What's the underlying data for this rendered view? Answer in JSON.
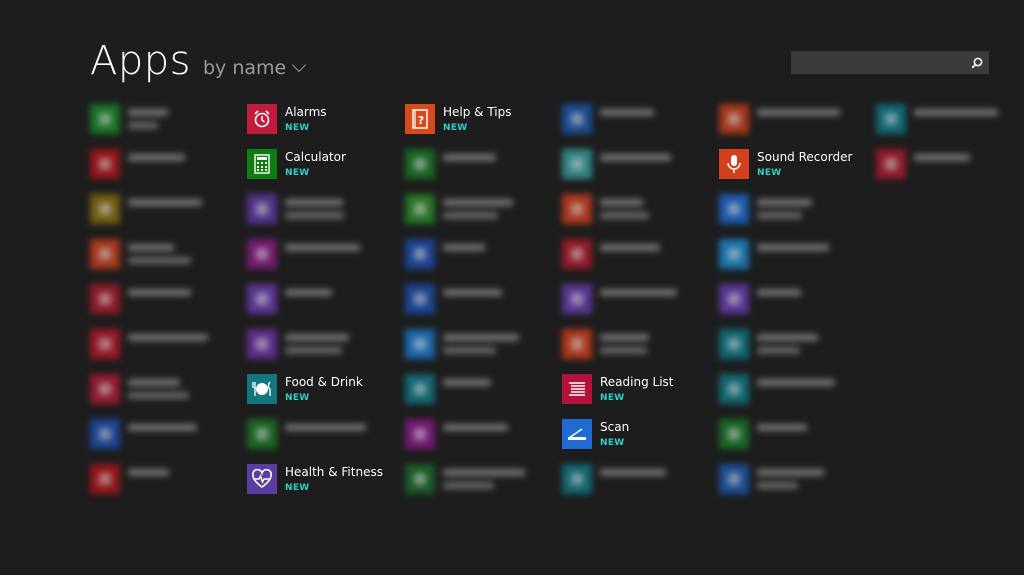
{
  "header": {
    "title": "Apps",
    "sort_label": "by name"
  },
  "search": {
    "placeholder": ""
  },
  "apps": {
    "alarms": {
      "name": "Alarms",
      "badge": "NEW",
      "color": "#c11b3d"
    },
    "calculator": {
      "name": "Calculator",
      "badge": "NEW",
      "color": "#0e7d12"
    },
    "food_drink": {
      "name": "Food & Drink",
      "badge": "NEW",
      "color": "#13757f"
    },
    "health_fitness": {
      "name": "Health & Fitness",
      "badge": "NEW",
      "color": "#5a3ea0"
    },
    "help_tips": {
      "name": "Help & Tips",
      "badge": "NEW",
      "color": "#d84a1b"
    },
    "reading_list": {
      "name": "Reading List",
      "badge": "NEW",
      "color": "#b3123a"
    },
    "scan": {
      "name": "Scan",
      "badge": "NEW",
      "color": "#1f6bd1"
    },
    "sound_recorder": {
      "name": "Sound Recorder",
      "badge": "NEW",
      "color": "#d2401e"
    }
  },
  "blurred_tiles": {
    "colors": [
      "#1c8a2c",
      "#b3141b",
      "#8a6d10",
      "#c9401e",
      "#a81c2c",
      "#b8192b",
      "#b01b34",
      "#1d4fb0",
      "#b3141b",
      "#5f3aa8",
      "#8b1b86",
      "#6a3db0",
      "#6e33a8",
      "#1d7a2a",
      "#1a7a2a",
      "#2a8a2a",
      "#1d4fb0",
      "#1d4fb0",
      "#1d7ad0",
      "#117a8a",
      "#8a1a8a",
      "#1a6a2a",
      "#1d5ab0",
      "#3aa0a0",
      "#d0401e",
      "#b01b30",
      "#6a3db0",
      "#d0401e",
      "#117a8a",
      "#c9401e",
      "#1d6ad0",
      "#1b8ad0",
      "#6a3db0",
      "#117a8a",
      "#117a8a",
      "#1a7a2a",
      "#1d5ab0",
      "#117a8a",
      "#b01b30",
      "#1d6ad0",
      "#c9401e"
    ]
  }
}
